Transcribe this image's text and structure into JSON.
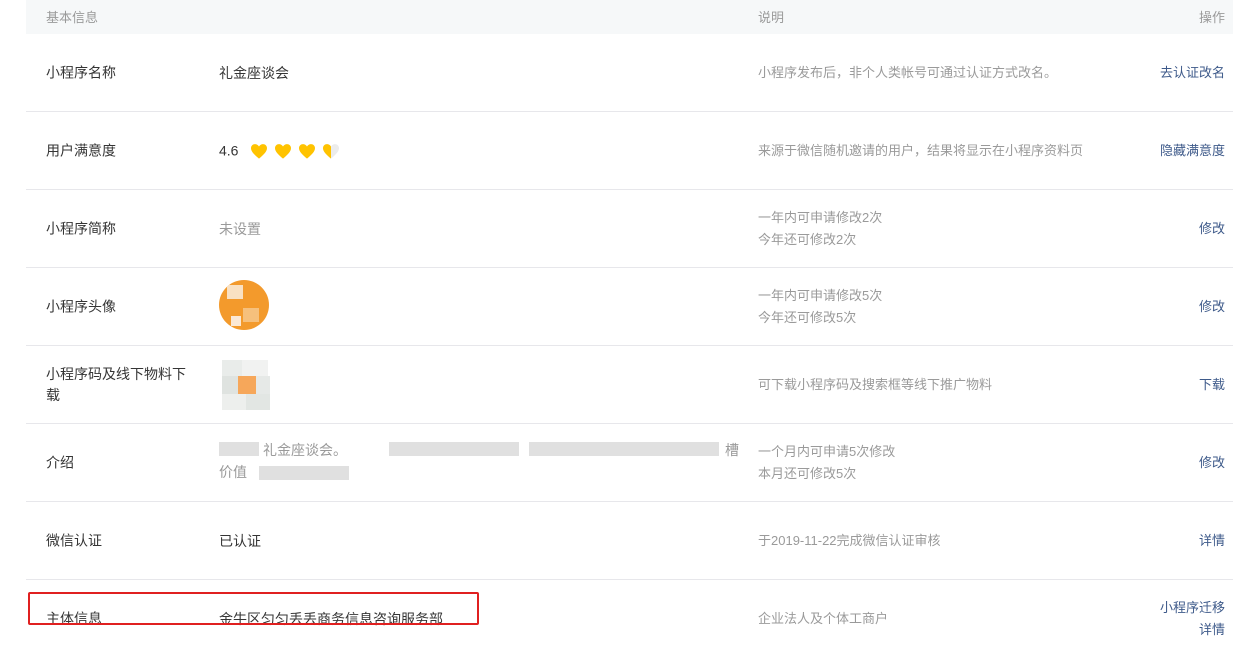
{
  "header": {
    "basic": "基本信息",
    "desc": "说明",
    "op": "操作"
  },
  "rows": [
    {
      "label": "小程序名称",
      "value": "礼金座谈会",
      "desc": "小程序发布后，非个人类帐号可通过认证方式改名。",
      "op": "去认证改名"
    },
    {
      "label": "用户满意度",
      "value": "4.6",
      "desc": "来源于微信随机邀请的用户，结果将显示在小程序资料页",
      "op": "隐藏满意度",
      "rating": 4.6,
      "heart_color": "#ffc300"
    },
    {
      "label": "小程序简称",
      "value": "未设置",
      "desc1": "一年内可申请修改2次",
      "desc2": "今年还可修改2次",
      "op": "修改"
    },
    {
      "label": "小程序头像",
      "desc1": "一年内可申请修改5次",
      "desc2": "今年还可修改5次",
      "op": "修改"
    },
    {
      "label1": "小程序码及线下物料下",
      "label2": "载",
      "desc": "可下载小程序码及搜索框等线下推广物料",
      "op": "下载"
    },
    {
      "label": "介绍",
      "value1": "礼金座谈会。",
      "value2": "价值",
      "value1_tail": "槽",
      "desc1": "一个月内可申请5次修改",
      "desc2": "本月还可修改5次",
      "op": "修改"
    },
    {
      "label": "微信认证",
      "value": "已认证",
      "desc": "于2019-11-22完成微信认证审核",
      "op": "详情"
    },
    {
      "label": "主体信息",
      "value": "金牛区匀匀丢丢商务信息咨询服务部",
      "desc": "企业法人及个体工商户",
      "op1": "小程序迁移",
      "op2": "详情"
    }
  ],
  "colors": {
    "link": "#3e5a8a",
    "highlight_border": "#e02020",
    "header_bg": "#f6f8f9"
  }
}
